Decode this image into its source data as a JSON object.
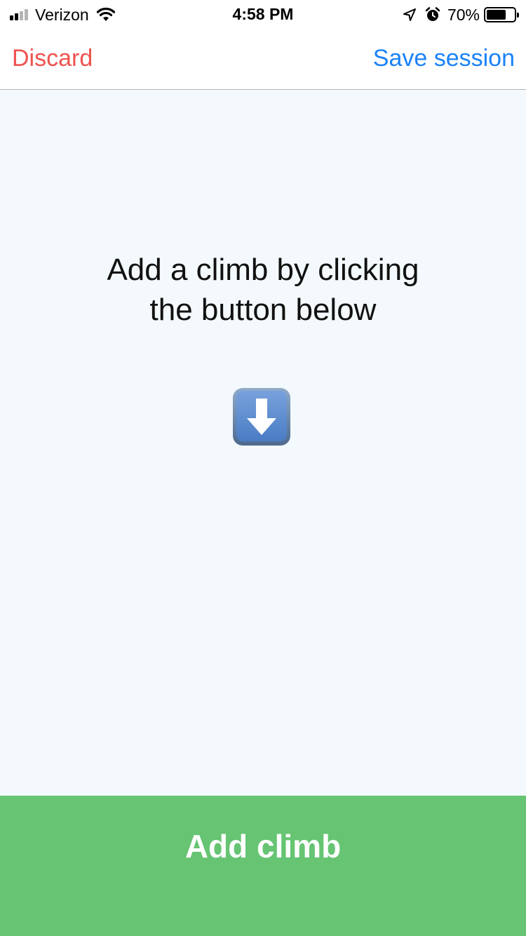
{
  "status_bar": {
    "carrier": "Verizon",
    "time": "4:58 PM",
    "battery_percent": "70%",
    "battery_level": 0.7,
    "signal_bars_filled": 2,
    "signal_bars_total": 4,
    "icons": [
      "signal-icon",
      "wifi-icon",
      "location-icon",
      "alarm-icon",
      "battery-icon"
    ]
  },
  "nav": {
    "discard_label": "Discard",
    "save_label": "Save session"
  },
  "main": {
    "instruction_line1": "Add a climb by clicking",
    "instruction_line2": "the button below",
    "arrow_icon": "down-arrow-emoji-icon"
  },
  "footer": {
    "add_climb_label": "Add climb"
  },
  "colors": {
    "discard": "#ef5350",
    "save": "#1a82f7",
    "content_background": "#f3f9fc",
    "add_button": "#66c472"
  }
}
